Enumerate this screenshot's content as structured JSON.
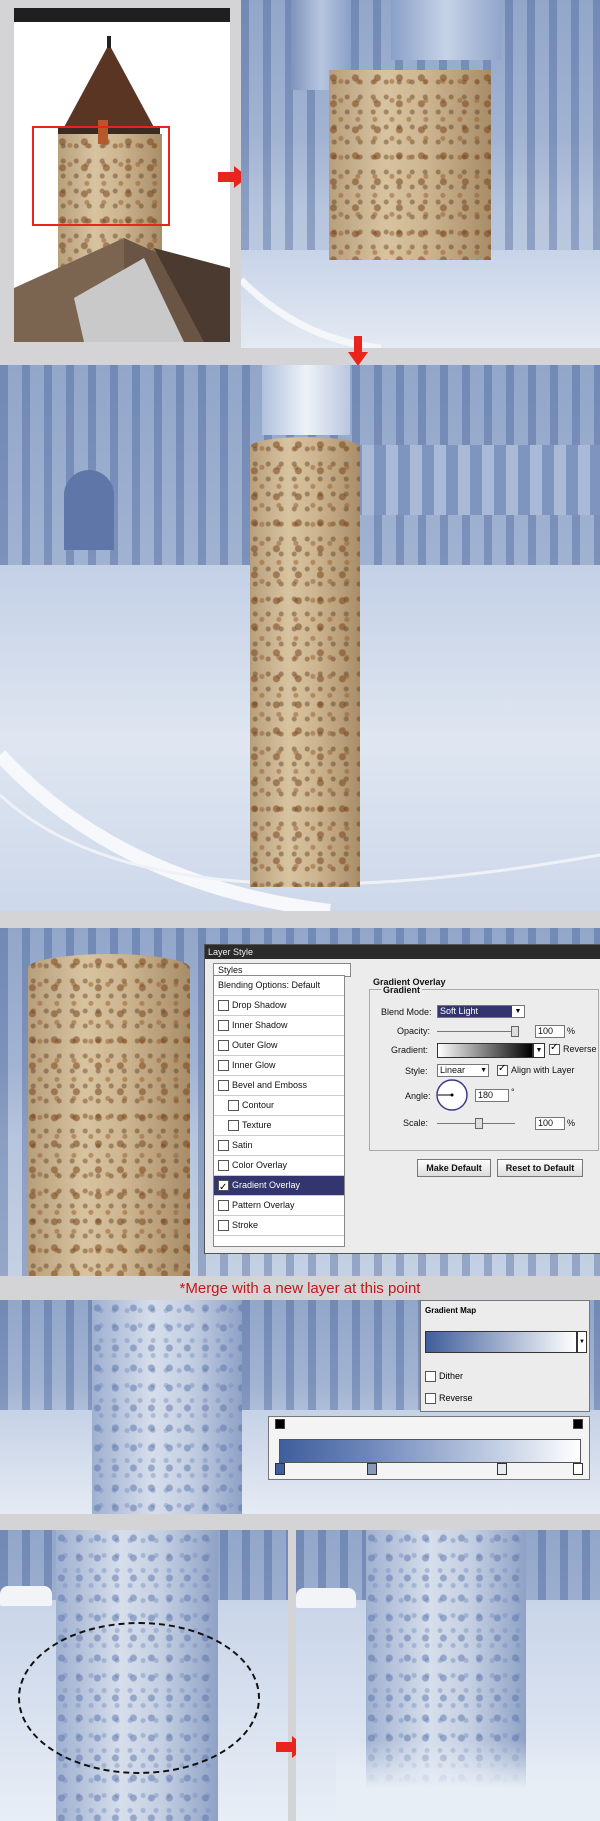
{
  "dialog": {
    "title": "Layer Style",
    "styles_header": "Styles",
    "items": [
      {
        "label": "Blending Options: Default",
        "checkbox": false,
        "checked": false,
        "selected": false,
        "indent": false
      },
      {
        "label": "Drop Shadow",
        "checkbox": true,
        "checked": false,
        "selected": false,
        "indent": false
      },
      {
        "label": "Inner Shadow",
        "checkbox": true,
        "checked": false,
        "selected": false,
        "indent": false
      },
      {
        "label": "Outer Glow",
        "checkbox": true,
        "checked": false,
        "selected": false,
        "indent": false
      },
      {
        "label": "Inner Glow",
        "checkbox": true,
        "checked": false,
        "selected": false,
        "indent": false
      },
      {
        "label": "Bevel and Emboss",
        "checkbox": true,
        "checked": false,
        "selected": false,
        "indent": false
      },
      {
        "label": "Contour",
        "checkbox": true,
        "checked": false,
        "selected": false,
        "indent": true
      },
      {
        "label": "Texture",
        "checkbox": true,
        "checked": false,
        "selected": false,
        "indent": true
      },
      {
        "label": "Satin",
        "checkbox": true,
        "checked": false,
        "selected": false,
        "indent": false
      },
      {
        "label": "Color Overlay",
        "checkbox": true,
        "checked": false,
        "selected": false,
        "indent": false
      },
      {
        "label": "Gradient Overlay",
        "checkbox": true,
        "checked": true,
        "selected": true,
        "indent": false
      },
      {
        "label": "Pattern Overlay",
        "checkbox": true,
        "checked": false,
        "selected": false,
        "indent": false
      },
      {
        "label": "Stroke",
        "checkbox": true,
        "checked": false,
        "selected": false,
        "indent": false
      }
    ],
    "section_title": "Gradient Overlay",
    "group_title": "Gradient",
    "blend_mode_label": "Blend Mode:",
    "blend_mode_value": "Soft Light",
    "opacity_label": "Opacity:",
    "opacity_value": "100",
    "percent": "%",
    "gradient_label": "Gradient:",
    "reverse_label": "Reverse",
    "reverse_checked": true,
    "style_label": "Style:",
    "style_value": "Linear",
    "align_label": "Align with Layer",
    "align_checked": true,
    "angle_label": "Angle:",
    "angle_value": "180",
    "degree": "°",
    "scale_label": "Scale:",
    "scale_value": "100",
    "make_default": "Make Default",
    "reset_default": "Reset to Default"
  },
  "note": "*Merge with a new layer at this point",
  "gradient_map": {
    "title": "Gradient Map",
    "dither_label": "Dither",
    "reverse_label": "Reverse"
  },
  "colors": {
    "arrow": "#e8241c",
    "selection_box": "#e8241c",
    "note_text": "#c0181c",
    "dialog_selected": "#33366e",
    "gradient_start": "#3f5e9c",
    "gradient_end": "#ffffff"
  }
}
